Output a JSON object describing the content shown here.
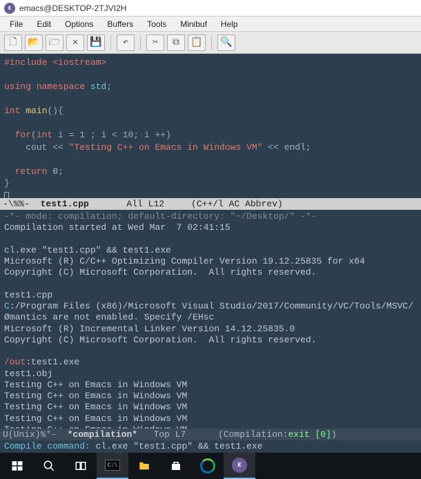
{
  "window": {
    "title": "emacs@DESKTOP-2TJVI2H"
  },
  "menubar": {
    "items": [
      "File",
      "Edit",
      "Options",
      "Buffers",
      "Tools",
      "Minibuf",
      "Help"
    ]
  },
  "toolbar": {
    "items": [
      {
        "name": "new-file-icon",
        "glyph": "🗋"
      },
      {
        "name": "open-file-icon",
        "glyph": "📂"
      },
      {
        "name": "open-dir-icon",
        "glyph": "🗁"
      },
      {
        "name": "close-icon",
        "glyph": "✕"
      },
      {
        "name": "save-icon",
        "glyph": "💾"
      },
      {
        "name": "undo-icon",
        "glyph": "↶"
      },
      {
        "name": "cut-icon",
        "glyph": "✂"
      },
      {
        "name": "copy-icon",
        "glyph": "⧉"
      },
      {
        "name": "paste-icon",
        "glyph": "📋"
      },
      {
        "name": "search-icon",
        "glyph": "🔍"
      }
    ]
  },
  "code": {
    "include_pre": "#include ",
    "include_hdr": "<iostream>",
    "using": "using ",
    "namespace": "namespace ",
    "std": "std",
    "int": "int ",
    "main": "main",
    "main_paren": "(){",
    "for": "for",
    "for_open": "(",
    "for_int": "int",
    "for_body": " i = 1 ; i < 10; i ++)",
    "cout": "    cout << ",
    "str": "\"Testing C++ on Emacs in Windows VM\"",
    "endl": " << endl;",
    "return": "return ",
    "zero": "0",
    "semi": ";",
    "rbrace": "}"
  },
  "modeline1": {
    "left": "-\\%%-  ",
    "bufname": "test1.cpp",
    "rest": "       All L12     (C++/l AC Abbrev)"
  },
  "compilation": {
    "header1": "-*- mode: compilation; default-directory: \"~/Desktop/\" -*-",
    "header2": "Compilation started at Wed Mar  7 02:41:15",
    "cmd": "cl.exe \"test1.cpp\" && test1.exe",
    "msvc1": "Microsoft (R) C/C++ Optimizing Compiler Version 19.12.25835 for x64",
    "msvc2": "Copyright (C) Microsoft Corporation.  All rights reserved.",
    "file": "test1.cpp",
    "path_pre": "C",
    "path_rest": ":/Program Files (x86)/Microsoft Visual Studio/2017/Community/VC/Tools/MSVC/",
    "warn": "Ømantics are not enabled. Specify /EHsc",
    "link1": "Microsoft (R) Incremental Linker Version 14.12.25835.0",
    "link2": "Copyright (C) Microsoft Corporation.  All rights reserved.",
    "out_pre": "/out",
    "out_rest": ":test1.exe",
    "obj": "test1.obj",
    "runline": "Testing C++ on Emacs in Windows VM"
  },
  "modeline2": {
    "left": "U(Unix)%*-  ",
    "bufname": "*compilation*",
    "mid": "   Top L7      (Compilation:",
    "exit": "exit [0]",
    "end": ")"
  },
  "minibuf": {
    "prompt": "Compile command: ",
    "cmd": "cl.exe \"test1.cpp\" && test1.exe"
  }
}
